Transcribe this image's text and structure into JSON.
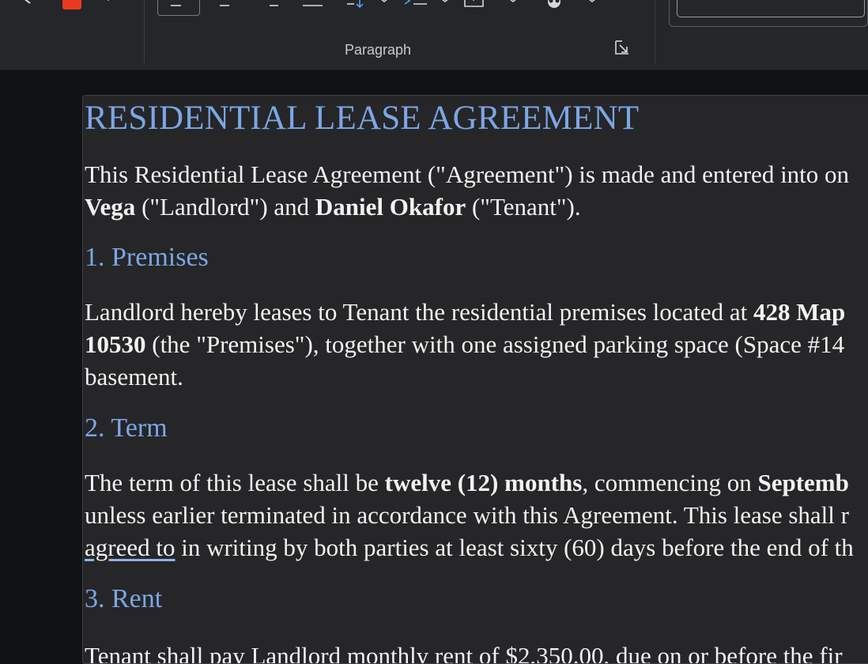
{
  "ribbon": {
    "paragraph_group_label": "Paragraph",
    "style_box_text": "",
    "accent_color": "#e83a20"
  },
  "document": {
    "title": "RESIDENTIAL LEASE AGREEMENT",
    "intro_line1_a": "This Residential Lease Agreement (\"Agreement\") is made and entered into on",
    "intro_line2_b1": "Vega",
    "intro_line2_a1": " (\"Landlord\") and ",
    "intro_line2_b2": "Daniel Okafor",
    "intro_line2_a2": " (\"Tenant\").",
    "section1_heading": "1. Premises",
    "s1_line1_a": "Landlord hereby leases to Tenant the residential premises located at ",
    "s1_line1_b": "428 Map",
    "s1_line2_b": "10530",
    "s1_line2_a": " (the \"Premises\"), together with one assigned parking space (Space #14",
    "s1_line3": "basement.",
    "section2_heading": "2. Term",
    "s2_line1_a": "The term of this lease shall be ",
    "s2_line1_b1": "twelve (12) months",
    "s2_line1_a2": ", commencing on ",
    "s2_line1_b2": "Septemb",
    "s2_line2": "unless earlier terminated in accordance with this Agreement. This lease shall r",
    "s2_line3_link": "agreed to",
    "s2_line3_a": " in writing by both parties at least sixty (60) days before the end of th",
    "section3_heading": "3. Rent",
    "s3_line1_partial": "Tenant shall pay Landlord monthly rent of $2,350.00, due on or before the fir"
  }
}
